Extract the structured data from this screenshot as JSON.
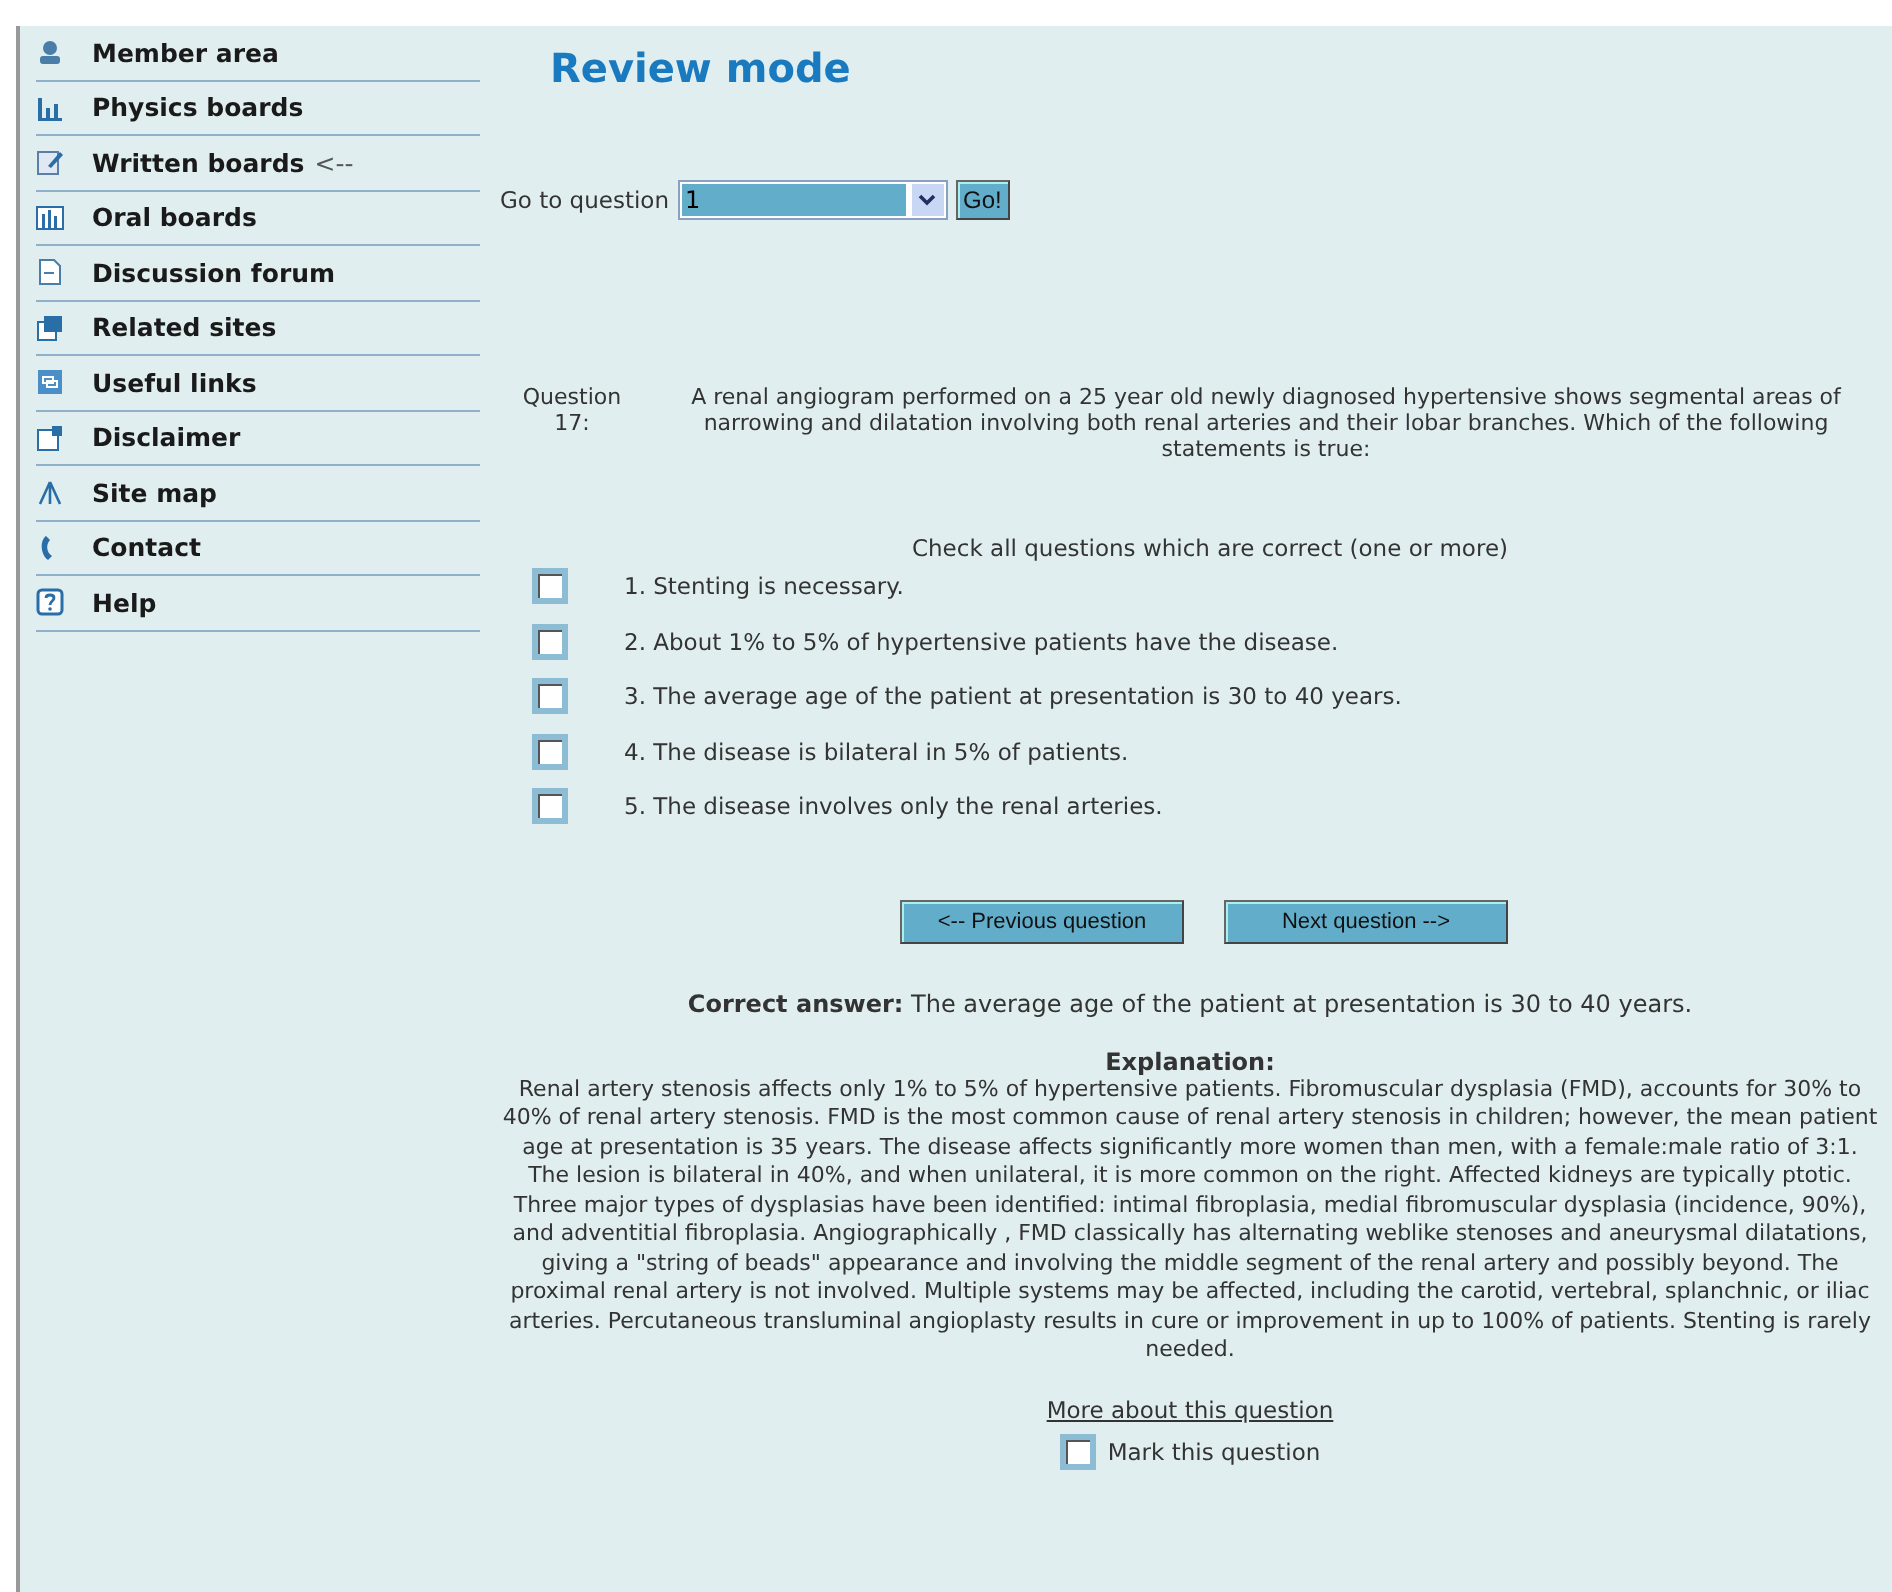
{
  "sidebar": {
    "items": [
      {
        "label": "Member area"
      },
      {
        "label": "Physics boards"
      },
      {
        "label": "Written boards",
        "suffix": "<--"
      },
      {
        "label": "Oral boards"
      },
      {
        "label": "Discussion forum"
      },
      {
        "label": "Related sites"
      },
      {
        "label": "Useful links"
      },
      {
        "label": "Disclaimer"
      },
      {
        "label": "Site map"
      },
      {
        "label": "Contact"
      },
      {
        "label": "Help"
      }
    ]
  },
  "title": "Review mode",
  "goto": {
    "label": "Go to question",
    "value": "1",
    "button": "Go!"
  },
  "question": {
    "label": "Question",
    "number": "17:",
    "text": "A renal angiogram performed on a 25 year old newly diagnosed hypertensive shows segmental areas of narrowing and dilatation involving both renal arteries and their lobar branches. Which of the following statements is true:"
  },
  "instruction": "Check all questions which are correct (one or more)",
  "options": [
    {
      "text": "1. Stenting is necessary.",
      "checked": false
    },
    {
      "text": "2. About 1% to 5% of hypertensive patients have the disease.",
      "checked": false
    },
    {
      "text": "3. The average age of the patient at presentation is 30 to 40 years.",
      "checked": false
    },
    {
      "text": "4. The disease is bilateral in 5% of patients.",
      "checked": false
    },
    {
      "text": "5. The disease involves only the renal arteries.",
      "checked": false
    }
  ],
  "nav": [
    "<-- Previous question",
    "Next question -->"
  ],
  "correct_answer": "**Correct answer:** The average age of the patient at presentation is 30 to 40 years.",
  "explanation": {
    "heading": "Explanation:",
    "text": "Renal artery stenosis affects only 1% to 5% of hypertensive patients. Fibromuscular dysplasia (FMD), accounts for 30% to 40% of renal artery stenosis. FMD is the most common cause of renal artery stenosis in children; however, the mean patient age at presentation is 35 years. The disease affects significantly more women than men, with a female:male ratio of 3:1. The lesion is bilateral in 40%, and when unilateral, it is more common on the right. Affected kidneys are typically ptotic. Three major types of dysplasias have been identified: intimal fibroplasia, medial fibromuscular dysplasia (incidence, 90%), and adventitial fibroplasia. Angiographically , FMD classically has alternating weblike stenoses and aneurysmal dilatations, giving a \"string of beads\" appearance and involving the middle segment of the renal artery and possibly beyond. The proximal renal artery is not involved. Multiple systems may be affected, including the carotid, vertebral, splanchnic, or iliac arteries. Percutaneous transluminal angioplasty results in cure or improvement in up to 100% of patients. Stenting is rarely needed."
  },
  "more_link": "More about this question",
  "mark": {
    "label": "Mark this question",
    "checked": false
  }
}
